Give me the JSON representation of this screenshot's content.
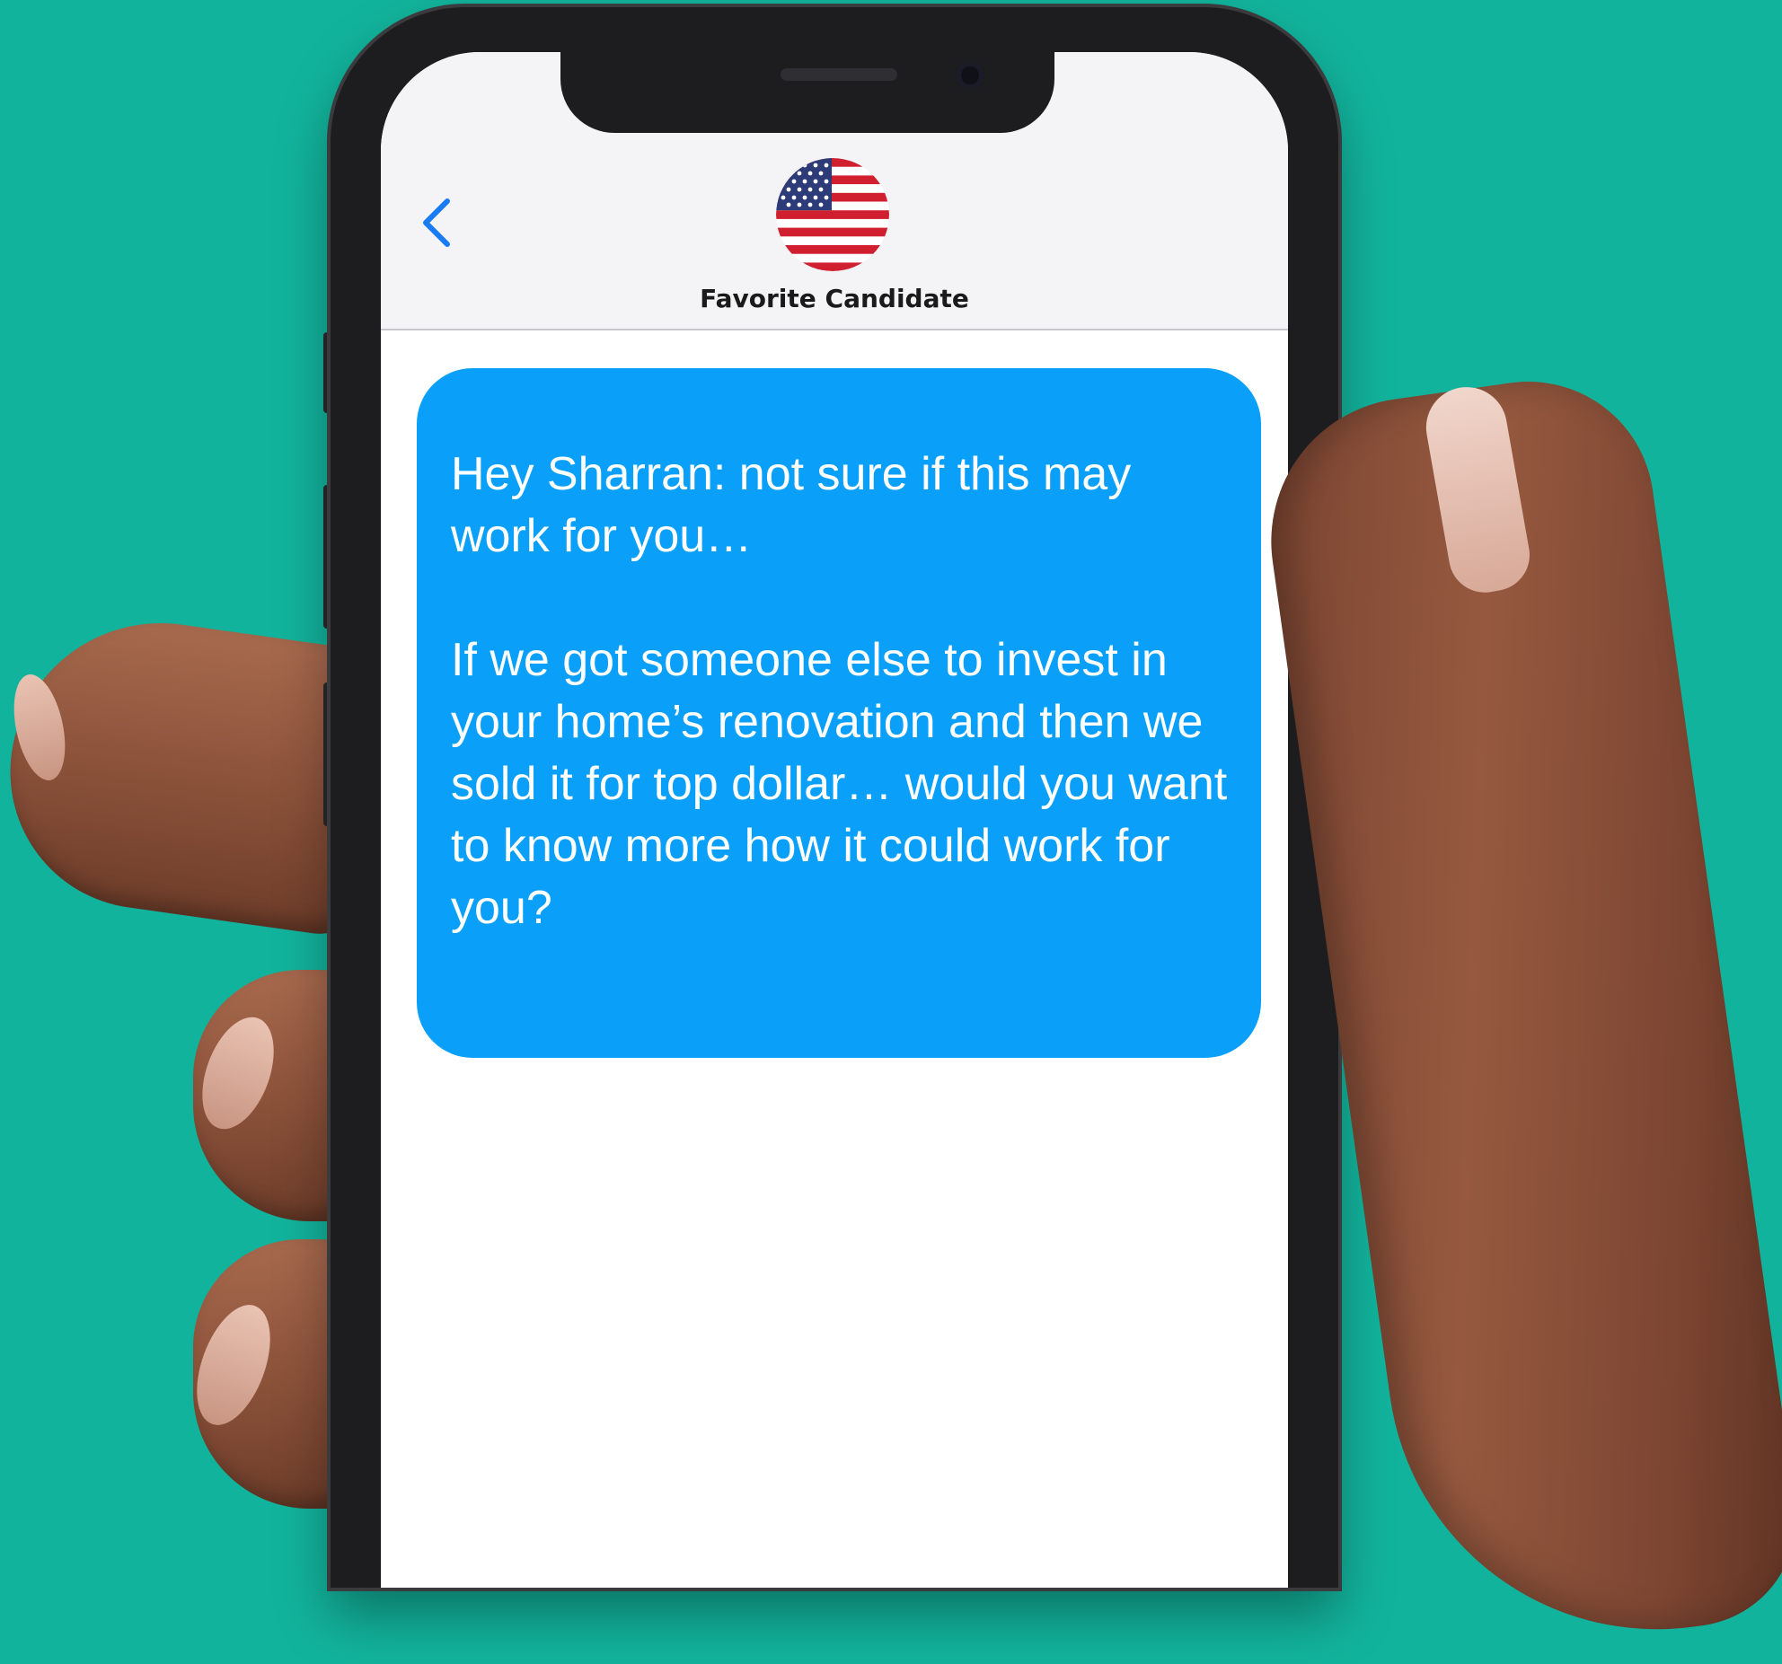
{
  "header": {
    "back_icon": "chevron-left-icon",
    "avatar_icon": "us-flag-icon",
    "contact_name": "Favorite Candidate"
  },
  "message": {
    "paragraph_1": "Hey Sharran: not sure if this may work for you…",
    "paragraph_2": "If we got someone else to invest in your home’s renovation and then we sold it for top dollar… would you want to know more how it could work for you?"
  },
  "colors": {
    "background": "#12b39c",
    "bubble": "#0aa0f9",
    "back_chevron": "#1a7cf5",
    "header_bg": "#f4f4f6"
  }
}
